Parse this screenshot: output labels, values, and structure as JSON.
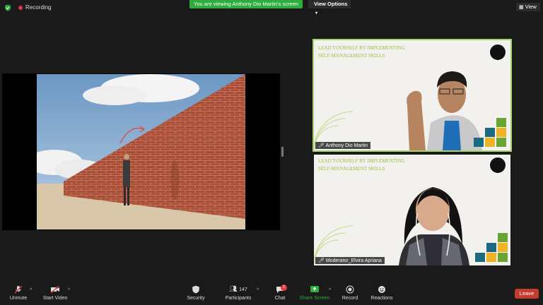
{
  "topbar": {
    "recording_label": "Recording",
    "viewing_banner": "You are viewing Anthony Dio Martin's screen",
    "view_options_label": "View Options",
    "view_button_label": "View"
  },
  "participants": [
    {
      "name": "Anthony Dio Martin",
      "slide_title_line1": "LEAD YOURSELF BY IMPLEMENTING",
      "slide_title_line2": "SELF-MANAGEMENT SKILLS",
      "active_speaker": true
    },
    {
      "name": "Moderator_Elvira Apriana",
      "slide_title_line1": "LEAD YOURSELF BY IMPLEMENTING",
      "slide_title_line2": "SELF-MANAGEMENT SKILLS",
      "active_speaker": false
    }
  ],
  "toolbar": {
    "unmute_label": "Unmute",
    "start_video_label": "Start Video",
    "security_label": "Security",
    "participants_label": "Participants",
    "participants_count": "147",
    "chat_label": "Chat",
    "chat_badge": "2",
    "share_screen_label": "Share Screen",
    "record_label": "Record",
    "reactions_label": "Reactions",
    "leave_label": "Leave"
  },
  "colors": {
    "share_green": "#2eac3e",
    "leave_red": "#c43c2f",
    "active_border": "#a8d26c",
    "background": "#1a1a1a"
  }
}
